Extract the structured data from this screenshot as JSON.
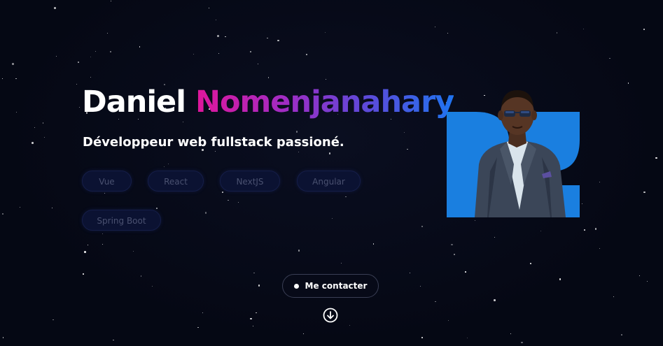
{
  "hero": {
    "first_name": "Daniel",
    "last_name": "Nomenjanahary",
    "tagline": "Développeur web fullstack passioné."
  },
  "skills": [
    "Vue",
    "React",
    "NextJS",
    "Angular",
    "Spring Boot"
  ],
  "cta": {
    "contact_label": "Me contacter"
  },
  "icons": {
    "scroll": "arrow-down-circle-icon",
    "contact_dot": "dot-icon"
  },
  "colors": {
    "background": "#050814",
    "name_gradient": [
      "#e0169b",
      "#a02cc4",
      "#5f48d8",
      "#1f74f0"
    ],
    "portrait_accent": "#1a7fe0"
  }
}
